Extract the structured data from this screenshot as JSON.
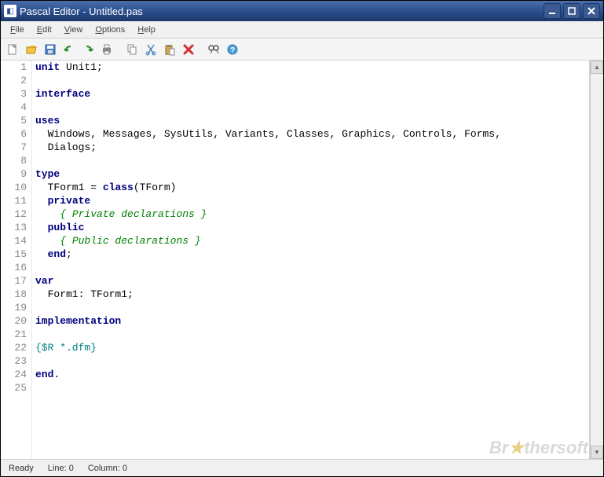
{
  "window": {
    "title": "Pascal Editor - Untitled.pas"
  },
  "menu": {
    "file": "File",
    "edit": "Edit",
    "view": "View",
    "options": "Options",
    "help": "Help"
  },
  "toolbar_icons": {
    "new": "new-file-icon",
    "open": "open-folder-icon",
    "save": "save-icon",
    "undo": "undo-icon",
    "redo": "redo-icon",
    "print": "print-icon",
    "copy": "copy-icon",
    "cut": "cut-icon",
    "paste": "paste-icon",
    "delete": "delete-icon",
    "find": "find-icon",
    "help": "help-icon"
  },
  "code": {
    "lines": [
      {
        "n": 1,
        "tokens": [
          {
            "t": "unit",
            "c": "kw"
          },
          {
            "t": " Unit1;",
            "c": ""
          }
        ]
      },
      {
        "n": 2,
        "tokens": []
      },
      {
        "n": 3,
        "tokens": [
          {
            "t": "interface",
            "c": "kw"
          }
        ]
      },
      {
        "n": 4,
        "tokens": []
      },
      {
        "n": 5,
        "tokens": [
          {
            "t": "uses",
            "c": "kw"
          }
        ]
      },
      {
        "n": 6,
        "tokens": [
          {
            "t": "  Windows, Messages, SysUtils, Variants, Classes, Graphics, Controls, Forms,",
            "c": ""
          }
        ]
      },
      {
        "n": 7,
        "tokens": [
          {
            "t": "  Dialogs;",
            "c": ""
          }
        ]
      },
      {
        "n": 8,
        "tokens": []
      },
      {
        "n": 9,
        "tokens": [
          {
            "t": "type",
            "c": "kw"
          }
        ]
      },
      {
        "n": 10,
        "tokens": [
          {
            "t": "  TForm1 = ",
            "c": ""
          },
          {
            "t": "class",
            "c": "kw"
          },
          {
            "t": "(TForm)",
            "c": ""
          }
        ]
      },
      {
        "n": 11,
        "tokens": [
          {
            "t": "  ",
            "c": ""
          },
          {
            "t": "private",
            "c": "kw"
          }
        ]
      },
      {
        "n": 12,
        "tokens": [
          {
            "t": "    ",
            "c": ""
          },
          {
            "t": "{ Private declarations }",
            "c": "cm"
          }
        ]
      },
      {
        "n": 13,
        "tokens": [
          {
            "t": "  ",
            "c": ""
          },
          {
            "t": "public",
            "c": "kw"
          }
        ]
      },
      {
        "n": 14,
        "tokens": [
          {
            "t": "    ",
            "c": ""
          },
          {
            "t": "{ Public declarations }",
            "c": "cm"
          }
        ]
      },
      {
        "n": 15,
        "tokens": [
          {
            "t": "  ",
            "c": ""
          },
          {
            "t": "end",
            "c": "kw"
          },
          {
            "t": ";",
            "c": ""
          }
        ]
      },
      {
        "n": 16,
        "tokens": []
      },
      {
        "n": 17,
        "tokens": [
          {
            "t": "var",
            "c": "kw"
          }
        ]
      },
      {
        "n": 18,
        "tokens": [
          {
            "t": "  Form1: TForm1;",
            "c": ""
          }
        ]
      },
      {
        "n": 19,
        "tokens": []
      },
      {
        "n": 20,
        "tokens": [
          {
            "t": "implementation",
            "c": "kw"
          }
        ]
      },
      {
        "n": 21,
        "tokens": []
      },
      {
        "n": 22,
        "tokens": [
          {
            "t": "{$R *.dfm}",
            "c": "dir"
          }
        ]
      },
      {
        "n": 23,
        "tokens": []
      },
      {
        "n": 24,
        "tokens": [
          {
            "t": "end",
            "c": "kw"
          },
          {
            "t": ".",
            "c": ""
          }
        ]
      },
      {
        "n": 25,
        "tokens": []
      }
    ]
  },
  "status": {
    "ready": "Ready",
    "line_label": "Line:",
    "line": "0",
    "col_label": "Column:",
    "col": "0"
  },
  "watermark": {
    "pre": "Br",
    "star": "★",
    "post": "thersoft"
  }
}
